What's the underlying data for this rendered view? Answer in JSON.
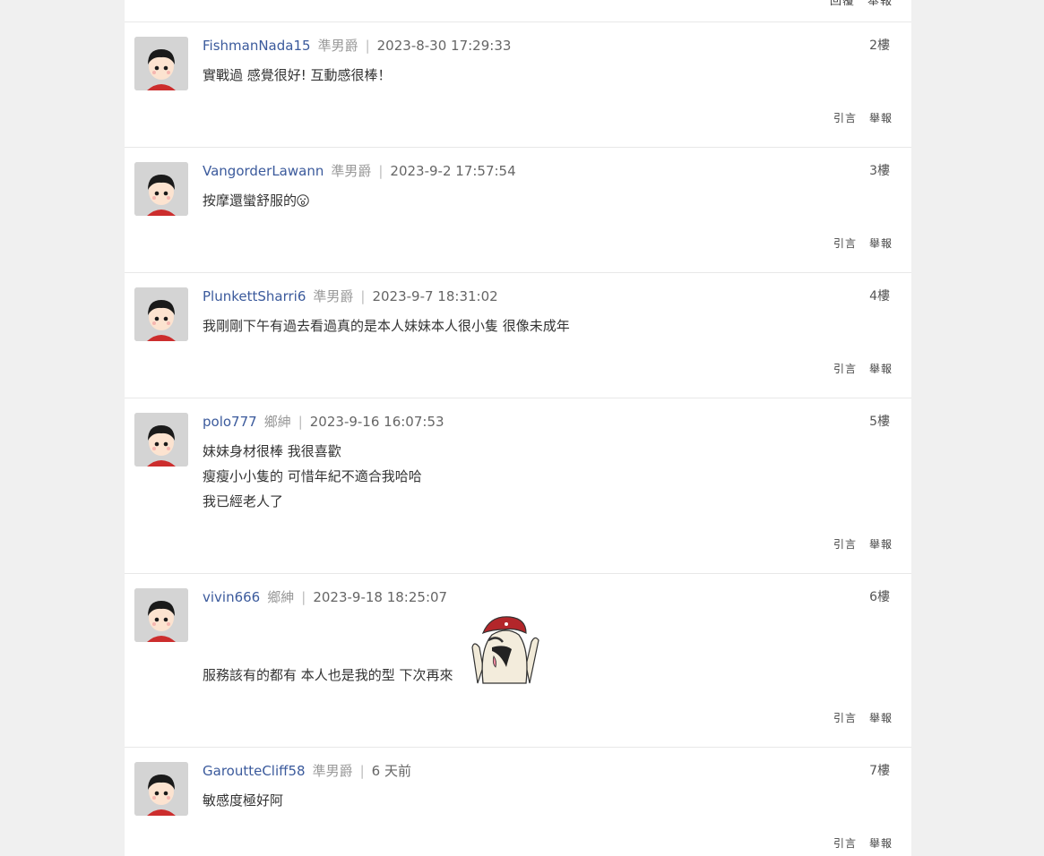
{
  "thread": {
    "top_actions": {
      "quote": "回覆",
      "report": "舉報"
    },
    "posts": [
      {
        "author": "FishmanNada15",
        "rank": "準男爵",
        "time": "2023-8-30 17:29:33",
        "floor": "2樓",
        "lines": [
          "實戰過 感覺很好! 互動感很棒！"
        ],
        "quote": "引言",
        "report": "舉報"
      },
      {
        "author": "VangorderLawann",
        "rank": "準男爵",
        "time": "2023-9-2 17:57:54",
        "floor": "3樓",
        "lines": [
          "按摩還蠻舒服的"
        ],
        "emoji": "surprised-face-emoji",
        "quote": "引言",
        "report": "舉報"
      },
      {
        "author": "PlunkettSharri6",
        "rank": "準男爵",
        "time": "2023-9-7 18:31:02",
        "floor": "4樓",
        "lines": [
          "我剛剛下午有過去看過真的是本人妹妹本人很小隻 很像未成年"
        ],
        "quote": "引言",
        "report": "舉報"
      },
      {
        "author": "polo777",
        "rank": "鄉紳",
        "time": "2023-9-16 16:07:53",
        "floor": "5樓",
        "lines": [
          "妹妹身材很棒 我很喜歡",
          "瘦瘦小小隻的 可惜年紀不適合我哈哈",
          "我已經老人了"
        ],
        "quote": "引言",
        "report": "舉報"
      },
      {
        "author": "vivin666",
        "rank": "鄉紳",
        "time": "2023-9-18 18:25:07",
        "floor": "6樓",
        "lines": [
          "服務該有的都有 本人也是我的型 下次再來"
        ],
        "sticker": "pirate-rock-hands-sticker",
        "quote": "引言",
        "report": "舉報"
      },
      {
        "author": "GaroutteCliff58",
        "rank": "準男爵",
        "time": "6 天前",
        "floor": "7樓",
        "lines": [
          "敏感度極好阿"
        ],
        "quote": "引言",
        "report": "舉報"
      }
    ]
  }
}
